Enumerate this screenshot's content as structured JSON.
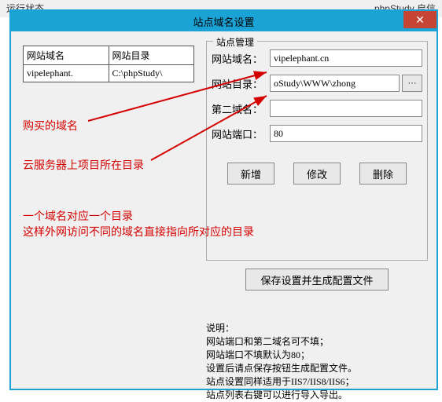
{
  "bg": {
    "left": "运行状态",
    "right": "phpStudy 启信"
  },
  "dialog_title": "站点域名设置",
  "close_label": "✕",
  "table": {
    "headers": [
      "网站域名",
      "网站目录"
    ],
    "row": {
      "domain": "vipelephant.",
      "dir": "C:\\phpStudy\\"
    }
  },
  "panel_legend": "站点管理",
  "fields": {
    "domain_label": "网站域名：",
    "domain_value": "vipelephant.cn",
    "dir_label": "网站目录：",
    "dir_value": "oStudy\\WWW\\zhong",
    "browse": "···",
    "second_domain_label": "第二域名：",
    "second_domain_value": "",
    "port_label": "网站端口：",
    "port_value": "80"
  },
  "buttons": {
    "add": "新增",
    "edit": "修改",
    "delete": "删除",
    "save": "保存设置并生成配置文件"
  },
  "annotations": {
    "a1": "购买的域名",
    "a2": "云服务器上项目所在目录",
    "a3": "一个域名对应一个目录",
    "a4": "这样外网访问不同的域名直接指向所对应的目录"
  },
  "help": {
    "h0": "说明：",
    "h1": "网站端口和第二域名可不填；",
    "h2": "网站端口不填默认为80；",
    "h3": "设置后请点保存按钮生成配置文件。",
    "h4": "站点设置同样适用于IIS7/IIS8/IIS6；",
    "h5": "站点列表右键可以进行导入导出。"
  }
}
